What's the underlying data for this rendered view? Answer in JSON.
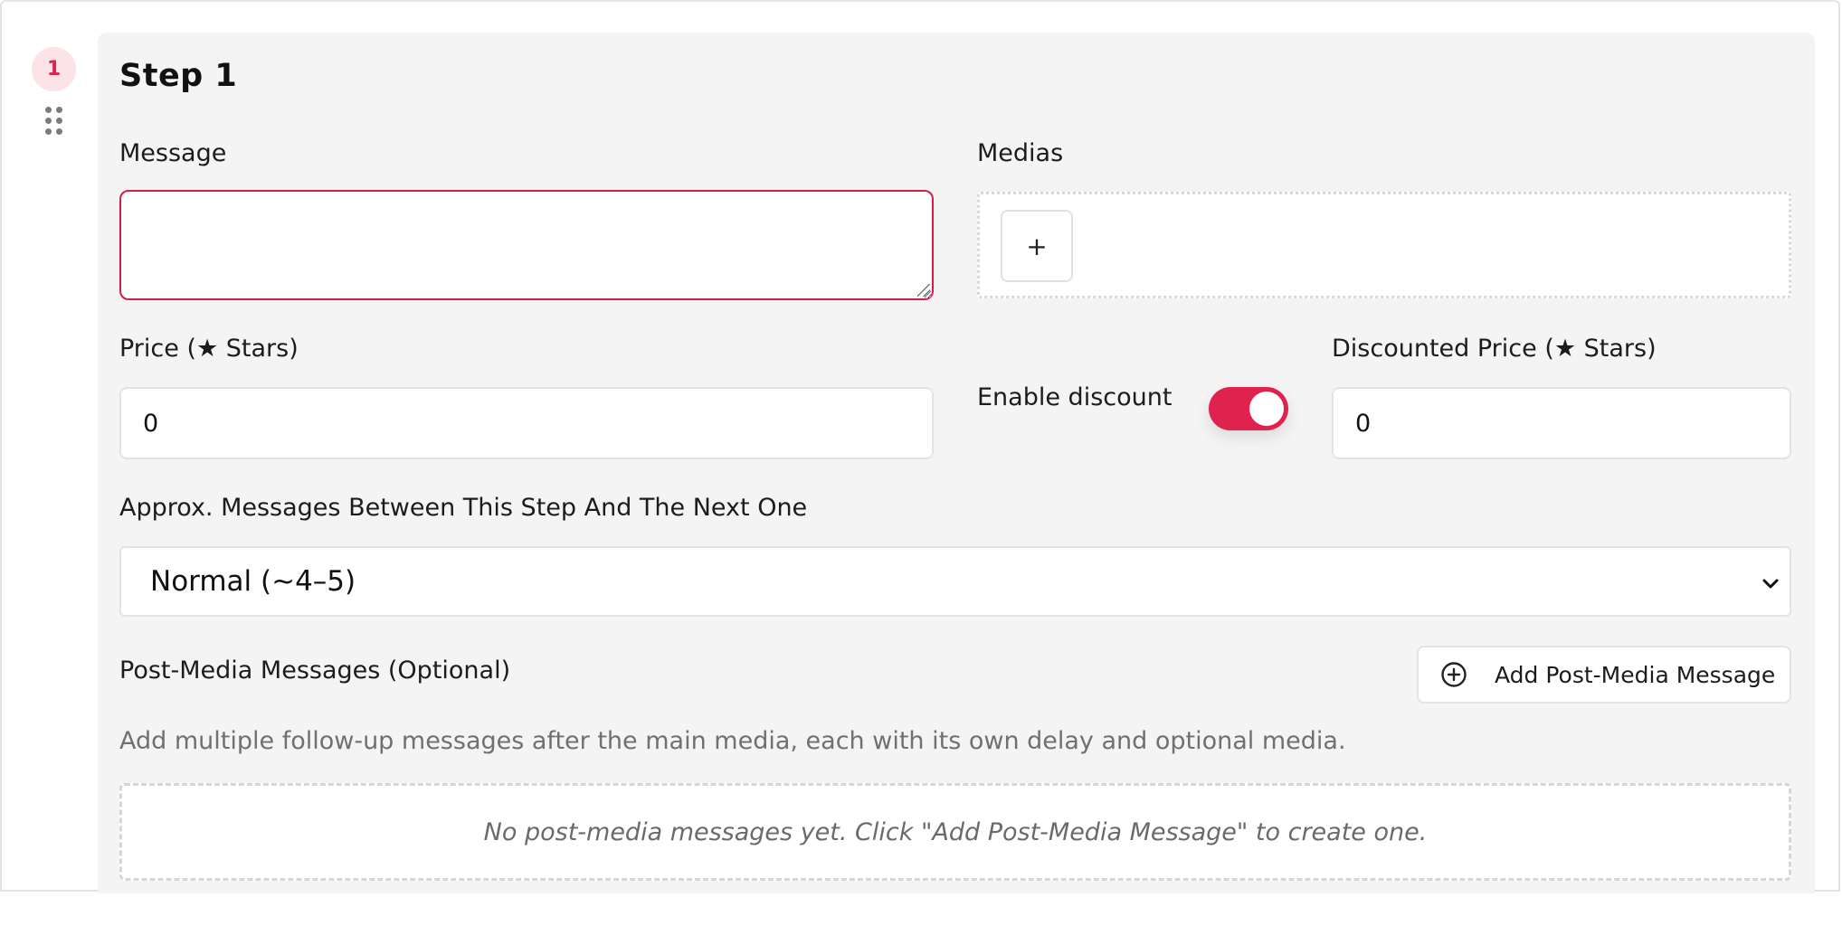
{
  "step": {
    "number": "1",
    "title": "Step 1"
  },
  "message": {
    "label": "Message",
    "value": ""
  },
  "medias": {
    "label": "Medias",
    "add_label": "+"
  },
  "price": {
    "label": "Price (★ Stars)",
    "value": "0"
  },
  "discount": {
    "enable_label": "Enable discount",
    "enabled": true,
    "label": "Discounted Price (★ Stars)",
    "value": "0"
  },
  "approx_messages": {
    "label": "Approx. Messages Between This Step And The Next One",
    "selected": "Normal (~4–5)"
  },
  "post_media": {
    "label": "Post-Media Messages (Optional)",
    "add_button_label": "Add Post-Media Message",
    "help_text": "Add multiple follow-up messages after the main media, each with its own delay and optional media.",
    "empty_text": "No post-media messages yet. Click \"Add Post-Media Message\" to create one."
  },
  "colors": {
    "accent": "#e0224f",
    "badge_bg": "#fbe3e8",
    "card_bg": "#f4f4f4"
  },
  "icons": {
    "drag": "drag-handle-icon",
    "chevron": "chevron-down-icon",
    "add": "plus-circle-icon"
  }
}
